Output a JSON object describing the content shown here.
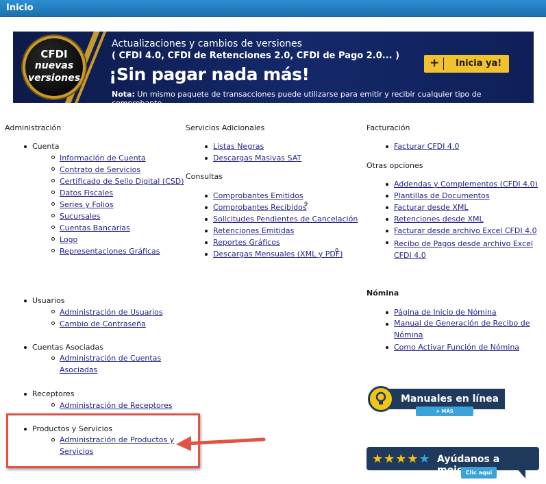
{
  "page": {
    "title": "Inicio"
  },
  "banner": {
    "badge_line1": "CFDI",
    "badge_line2": "nuevas",
    "badge_line3": "versiones",
    "line1": "Actualizaciones y cambios de versiones",
    "line2": "( CFDI 4.0, CFDI de Retenciones 2.0, CFDI de Pago 2.0... )",
    "headline": "¡Sin pagar nada más!",
    "note_label": "Nota:",
    "note_text": " Un mismo paquete de transacciones puede utilizarse para emitir y recibir cualquier tipo de comprobante.",
    "cta_plus": "+",
    "cta_label": "Inicia ya!"
  },
  "administracion": {
    "heading": "Administración",
    "cuenta": {
      "label": "Cuenta",
      "items": [
        "Información de Cuenta",
        "Contrato de Servicios",
        "Certificado de Sello Digital (CSD)",
        "Datos Fiscales",
        "Series y Folios",
        "Sucursales",
        "Cuentas Bancarias",
        "Logo",
        "Representaciones Gráficas"
      ]
    },
    "usuarios": {
      "label": "Usuarios",
      "items": [
        "Administración de Usuarios",
        "Cambio de Contraseña"
      ]
    },
    "cuentas_asociadas": {
      "label": "Cuentas Asociadas",
      "items": [
        "Administración de Cuentas Asociadas"
      ]
    },
    "receptores": {
      "label": "Receptores",
      "items": [
        "Administración de Receptores"
      ]
    },
    "productos": {
      "label": "Productos y Servicios",
      "items": [
        "Administración de Productos y Servicios"
      ]
    }
  },
  "servicios_adicionales": {
    "heading": "Servicios Adicionales",
    "items": [
      "Listas Negras",
      "Descargas Masivas SAT"
    ]
  },
  "consultas": {
    "heading": "Consultas",
    "items": [
      "Comprobantes Emitidos",
      "Comprobantes Recibidos",
      "Solicitudes Pendientes de Cancelación",
      "Retenciones Emitidas",
      "Reportes Gráficos",
      "Descargas Mensuales (XML y PDF)"
    ],
    "recibidos_count": "9",
    "descargas_count": "0"
  },
  "facturacion": {
    "heading": "Facturación",
    "items": [
      "Facturar CFDI 4.0"
    ]
  },
  "otras_opciones": {
    "heading": "Otras opciones",
    "items": [
      "Addendas y Complementos (CFDI 4.0)",
      "Plantillas de Documentos",
      "Facturar desde XML",
      "Retenciones desde XML",
      "Facturar desde archivo Excel CFDI 4.0",
      "Recibo de Pagos desde archivo Excel CFDI 4.0"
    ]
  },
  "nomina": {
    "heading": "Nómina",
    "items": [
      "Página de Inicio de Nómina",
      "Manual de Generación de Recibo de Nómina",
      "Como Activar Función de Nómina"
    ]
  },
  "manuales": {
    "title": "Manuales en línea",
    "button": "+ MÁS INFORMACIÓN"
  },
  "ayudanos": {
    "stars": "★★★★",
    "star_empty": "★",
    "title": "Ayúdanos a mejorar",
    "button": "Clic aquí"
  },
  "colors": {
    "topbar": "#1b6fae",
    "highlight": "#e25245",
    "link": "#1f1f8a",
    "cta": "#f2c12e",
    "widget": "#1f3a5c"
  }
}
